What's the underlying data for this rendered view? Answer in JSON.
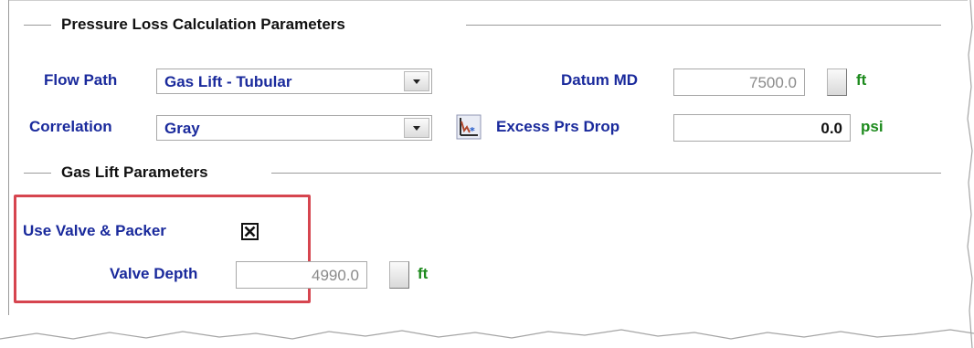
{
  "pressure_loss": {
    "title": "Pressure Loss Calculation Parameters",
    "flow_path_label": "Flow Path",
    "flow_path_value": "Gas Lift - Tubular",
    "correlation_label": "Correlation",
    "correlation_value": "Gray",
    "datum_md_label": "Datum MD",
    "datum_md_value": "7500.0",
    "datum_md_unit": "ft",
    "excess_prs_drop_label": "Excess Prs Drop",
    "excess_prs_drop_value": "0.0",
    "excess_prs_drop_unit": "psi"
  },
  "gas_lift": {
    "title": "Gas Lift Parameters",
    "use_valve_packer_label": "Use Valve & Packer",
    "use_valve_packer_checked": true,
    "valve_depth_label": "Valve Depth",
    "valve_depth_value": "4990.0",
    "valve_depth_unit": "ft"
  },
  "icons": {
    "correlation_chart": "correlation-chart-icon",
    "checkbox_mark": "x-check-icon",
    "dropdown": "chevron-down-icon"
  },
  "colors": {
    "label_blue": "#1a2a9c",
    "unit_green": "#1d8a1d",
    "highlight_red": "#d6454f"
  }
}
